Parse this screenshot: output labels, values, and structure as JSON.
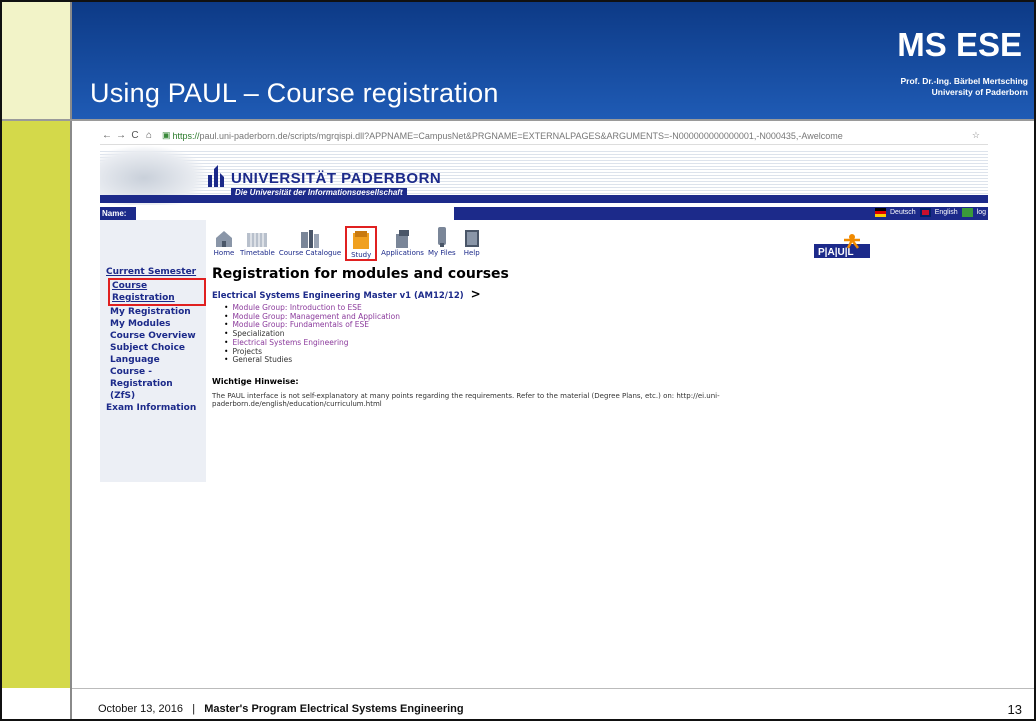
{
  "slide": {
    "title": "Using PAUL – Course registration",
    "brand": "MS ESE",
    "author": "Prof. Dr.-Ing. Bärbel Mertsching",
    "institution": "University of Paderborn",
    "footer_date": "October 13, 2016",
    "footer_sep": "|",
    "footer_program": "Master's Program Electrical Systems Engineering",
    "page_number": "13",
    "colors": {
      "header_blue": "#1f5bb5",
      "accent_green": "#d4d94a"
    }
  },
  "browser": {
    "back_icon": "←",
    "forward_icon": "→",
    "reload_icon": "C",
    "home_icon": "⌂",
    "url_scheme": "https://",
    "url_rest": "paul.uni-paderborn.de/scripts/mgrqispi.dll?APPNAME=CampusNet&PRGNAME=EXTERNALPAGES&ARGUMENTS=-N000000000000001,-N000435,-Awelcome",
    "star_icon": "☆"
  },
  "site": {
    "uni_name": "UNIVERSITÄT PADERBORN",
    "uni_tagline": "Die Universität der Informationsgesellschaft",
    "name_label": "Name:",
    "lang": [
      "Deutsch",
      "English",
      "log"
    ],
    "paul_logo": "P|A|U|L"
  },
  "sidebar": {
    "heading": "Current Semester",
    "items": [
      "Course Registration",
      "My Registration",
      "My Modules",
      "Course Overview",
      "Subject Choice",
      "Language Course - Registration (ZfS)"
    ],
    "exam": "Exam Information"
  },
  "toolbar": {
    "items": [
      "Home",
      "Timetable",
      "Course Catalogue",
      "Study",
      "Applications",
      "My Files",
      "Help"
    ],
    "selected": "Study"
  },
  "main": {
    "heading": "Registration for modules and courses",
    "program": "Electrical Systems Engineering Master v1 (AM12/12)",
    "program_arrow": ">",
    "links": [
      "Module Group: Introduction to ESE",
      "Module Group: Management and Application",
      "Module Group: Fundamentals of ESE",
      "Specialization",
      "Electrical Systems Engineering",
      "Projects",
      "General Studies"
    ],
    "hinweise_label": "Wichtige Hinweise:",
    "note": "The PAUL interface is not self-explanatory at many points regarding the requirements. Refer to the material (Degree Plans, etc.) on: http://ei.uni-paderborn.de/english/education/curriculum.html"
  }
}
